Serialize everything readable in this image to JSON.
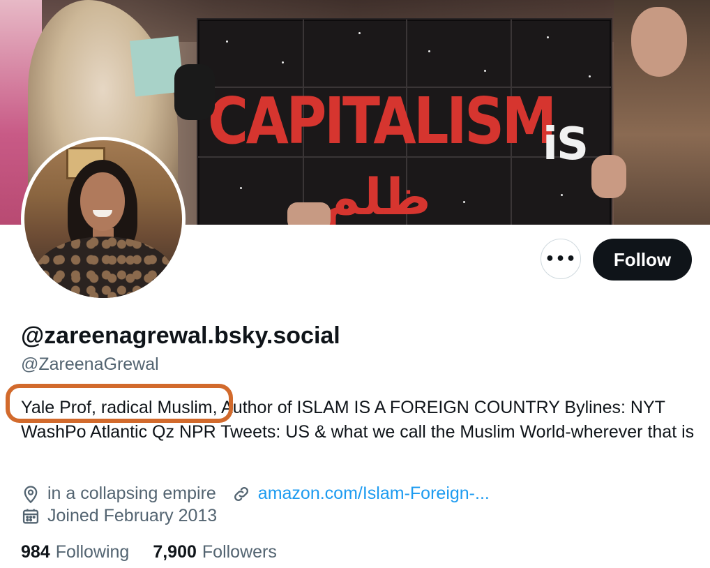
{
  "banner": {
    "sign_text": "CAPITALISM",
    "sign_is": "iS",
    "sign_arabic": "ظلم"
  },
  "actions": {
    "more_label": "•••",
    "follow_label": "Follow"
  },
  "profile": {
    "display_name": "@zareenagrewal.bsky.social",
    "handle": "@ZareenaGrewal",
    "bio": "Yale Prof, radical Muslim, Author of ISLAM IS A FOREIGN COUNTRY Bylines: NYT WashPo Atlantic Qz NPR Tweets: US & what we call the Muslim World-wherever that is",
    "location": "in a collapsing empire",
    "website": "amazon.com/Islam-Foreign-...",
    "joined": "Joined February 2013"
  },
  "stats": {
    "following_count": "984",
    "following_label": "Following",
    "followers_count": "7,900",
    "followers_label": "Followers"
  },
  "colors": {
    "highlight": "#d26a2c",
    "link": "#1d9bf0",
    "muted": "#536471",
    "follow_bg": "#0f1419"
  },
  "icons": {
    "location": "location-pin-icon",
    "website": "link-icon",
    "joined": "calendar-icon",
    "more": "more-dots-icon"
  }
}
